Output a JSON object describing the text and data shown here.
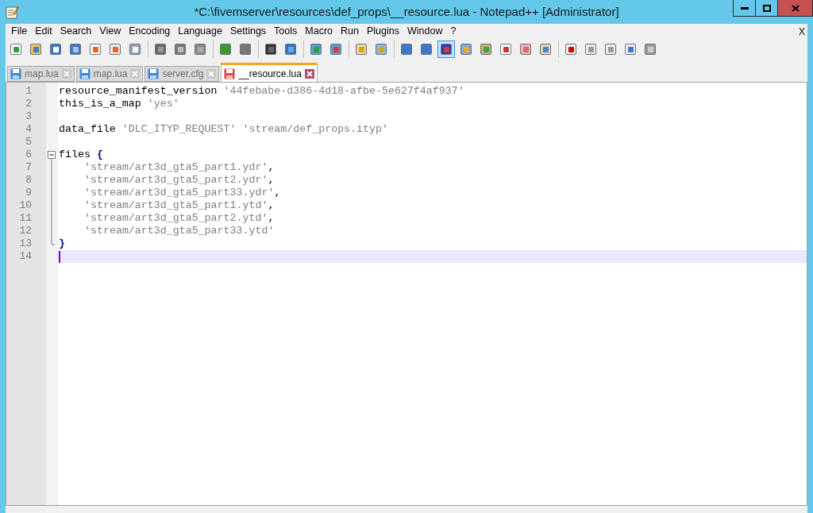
{
  "window": {
    "title": "*C:\\fivemserver\\resources\\def_props\\__resource.lua - Notepad++ [Administrator]"
  },
  "menu": [
    "File",
    "Edit",
    "Search",
    "View",
    "Encoding",
    "Language",
    "Settings",
    "Tools",
    "Macro",
    "Run",
    "Plugins",
    "Window",
    "?"
  ],
  "menu_close": "X",
  "toolbar": [
    [
      {
        "pressed": false
      },
      {
        "pressed": false
      },
      {
        "pressed": false
      },
      {
        "pressed": false
      },
      {
        "pressed": false
      },
      {
        "pressed": false
      },
      {
        "pressed": false
      }
    ],
    [
      {
        "pressed": false
      },
      {
        "pressed": false
      },
      {
        "pressed": false
      }
    ],
    [
      {
        "pressed": false
      },
      {
        "pressed": false
      }
    ],
    [
      {
        "pressed": false
      },
      {
        "pressed": false
      }
    ],
    [
      {
        "pressed": false
      },
      {
        "pressed": false
      }
    ],
    [
      {
        "pressed": false
      },
      {
        "pressed": false
      }
    ],
    [
      {
        "pressed": false
      },
      {
        "pressed": false
      },
      {
        "pressed": true
      },
      {
        "pressed": false
      },
      {
        "pressed": false
      },
      {
        "pressed": false
      },
      {
        "pressed": false
      },
      {
        "pressed": false
      }
    ],
    [
      {
        "pressed": false
      },
      {
        "pressed": false
      },
      {
        "pressed": false
      },
      {
        "pressed": false
      },
      {
        "pressed": false
      }
    ]
  ],
  "tabs": [
    {
      "label": "map.lua",
      "selected": false,
      "modified": false
    },
    {
      "label": "map.lua",
      "selected": false,
      "modified": false
    },
    {
      "label": "server.cfg",
      "selected": false,
      "modified": false
    },
    {
      "label": "__resource.lua",
      "selected": true,
      "modified": true
    }
  ],
  "editor": {
    "lines": [
      {
        "number": "1",
        "kind": "plain",
        "tokens": [
          {
            "kind": "ident",
            "text": "resource_manifest_version"
          },
          {
            "kind": "string",
            "text": "'44febabe-d386-4d18-afbe-5e627f4af937'"
          }
        ]
      },
      {
        "number": "2",
        "kind": "plain",
        "tokens": [
          {
            "kind": "ident",
            "text": "this_is_a_map"
          },
          {
            "kind": "string",
            "text": "'yes'"
          }
        ]
      },
      {
        "number": "3",
        "kind": "plain"
      },
      {
        "number": "4",
        "kind": "plain",
        "tokens": [
          {
            "kind": "ident",
            "text": "data_file"
          },
          {
            "kind": "string",
            "text": "'DLC_ITYP_REQUEST'"
          },
          {
            "kind": "string",
            "text": "'stream/def_props.ityp'"
          }
        ]
      },
      {
        "number": "5",
        "kind": "plain"
      },
      {
        "number": "6",
        "kind": "fold_start",
        "tokens": [
          {
            "kind": "ident",
            "text": "files"
          },
          {
            "kind": "brace",
            "text": "{"
          }
        ]
      },
      {
        "number": "7",
        "kind": "fold_body",
        "tokens": [
          {
            "kind": "string",
            "text": "'stream/art3d_gta5_part1.ydr'"
          },
          {
            "kind": "punct",
            "text": ","
          }
        ]
      },
      {
        "number": "8",
        "kind": "fold_body",
        "tokens": [
          {
            "kind": "string",
            "text": "'stream/art3d_gta5_part2.ydr'"
          },
          {
            "kind": "punct",
            "text": ","
          }
        ]
      },
      {
        "number": "9",
        "kind": "fold_body",
        "tokens": [
          {
            "kind": "string",
            "text": "'stream/art3d_gta5_part33.ydr'"
          },
          {
            "kind": "punct",
            "text": ","
          }
        ]
      },
      {
        "number": "10",
        "kind": "fold_body",
        "tokens": [
          {
            "kind": "string",
            "text": "'stream/art3d_gta5_part1.ytd'"
          },
          {
            "kind": "punct",
            "text": ","
          }
        ]
      },
      {
        "number": "11",
        "kind": "fold_body",
        "tokens": [
          {
            "kind": "string",
            "text": "'stream/art3d_gta5_part2.ytd'"
          },
          {
            "kind": "punct",
            "text": ","
          }
        ]
      },
      {
        "number": "12",
        "kind": "fold_body",
        "tokens": [
          {
            "kind": "string",
            "text": "'stream/art3d_gta5_part33.ytd'"
          }
        ]
      },
      {
        "number": "13",
        "kind": "fold_end",
        "tokens": [
          {
            "kind": "brace",
            "text": "}"
          }
        ]
      },
      {
        "number": "14",
        "kind": "plain",
        "current": true
      }
    ]
  }
}
